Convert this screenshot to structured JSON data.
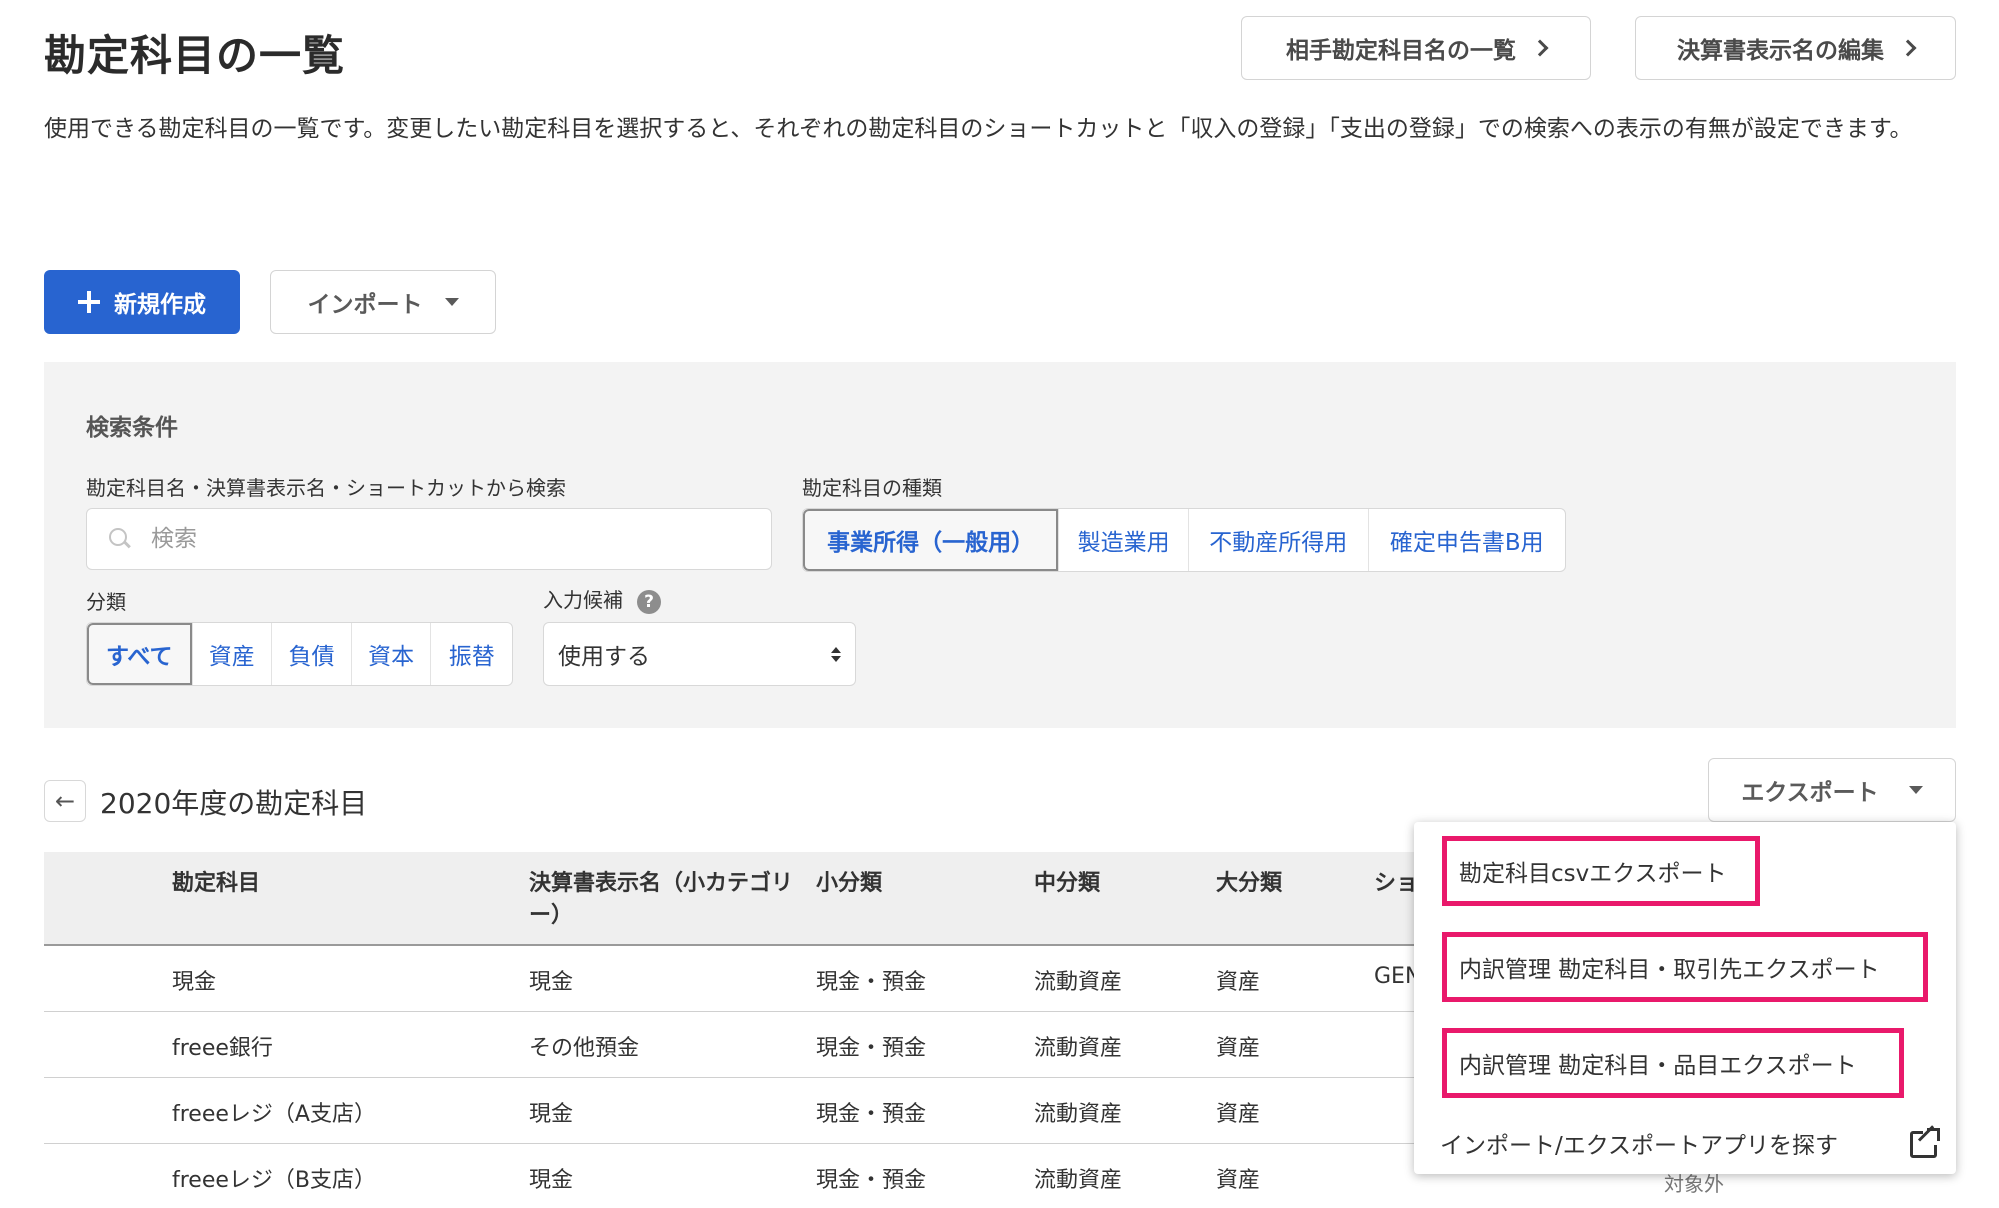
{
  "header": {
    "title": "勘定科目の一覧",
    "counterpart_button": "相手勘定科目名の一覧",
    "statement_button": "決算書表示名の編集",
    "description": "使用できる勘定科目の一覧です。変更したい勘定科目を選択すると、それぞれの勘定科目のショートカットと「収入の登録」「支出の登録」での検索への表示の有無が設定できます。"
  },
  "actions": {
    "new_button": "新規作成",
    "import_button": "インポート"
  },
  "search": {
    "title": "検索条件",
    "query_label": "勘定科目名・決算書表示名・ショートカットから検索",
    "query_placeholder": "検索",
    "type_label": "勘定科目の種類",
    "types": [
      "事業所得（一般用）",
      "製造業用",
      "不動産所得用",
      "確定申告書B用"
    ],
    "category_label": "分類",
    "categories": [
      "すべて",
      "資産",
      "負債",
      "資本",
      "振替"
    ],
    "suggest_label": "入力候補",
    "suggest_help": "?",
    "suggest_value": "使用する"
  },
  "list": {
    "back_icon": "←",
    "title": "2020年度の勘定科目",
    "export_button": "エクスポート"
  },
  "table": {
    "columns": [
      "勘定科目",
      "決算書表示名（小カテゴリー）",
      "小分類",
      "中分類",
      "大分類",
      "ショ"
    ],
    "rows": [
      [
        "現金",
        "現金",
        "現金・預金",
        "流動資産",
        "資産",
        "GEN"
      ],
      [
        "freee銀行",
        "その他預金",
        "現金・預金",
        "流動資産",
        "資産",
        ""
      ],
      [
        "freeeレジ（A支店）",
        "現金",
        "現金・預金",
        "流動資産",
        "資産",
        ""
      ],
      [
        "freeeレジ（B支店）",
        "現金",
        "現金・預金",
        "流動資産",
        "資産",
        ""
      ]
    ],
    "partial_status": "対象外"
  },
  "export_menu": {
    "items": [
      "勘定科目csvエクスポート",
      "内訳管理 勘定科目・取引先エクスポート",
      "内訳管理 勘定科目・品目エクスポート"
    ],
    "find_apps": "インポート/エクスポートアプリを探す",
    "highlight_color": "#e9196b"
  },
  "colors": {
    "primary": "#2864d0",
    "panel_bg": "#f3f3f3"
  }
}
